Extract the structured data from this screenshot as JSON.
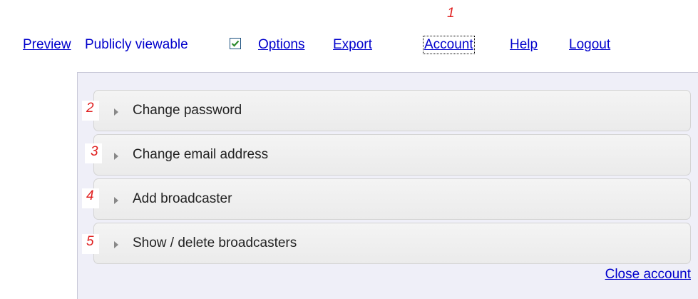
{
  "nav": {
    "preview": "Preview",
    "publicly_viewable": "Publicly viewable",
    "publicly_viewable_checked": true,
    "options": "Options",
    "export": "Export",
    "account": "Account",
    "help": "Help",
    "logout": "Logout"
  },
  "markers": [
    "1",
    "2",
    "3",
    "4",
    "5"
  ],
  "sections": [
    {
      "label": "Change password"
    },
    {
      "label": "Change email address"
    },
    {
      "label": "Add broadcaster"
    },
    {
      "label": "Show / delete broadcasters"
    }
  ],
  "close_account": "Close account",
  "colors": {
    "link": "#0000cc",
    "marker": "#e02020",
    "panel_bg": "#efeff8",
    "checkmark": "#2e8b2e"
  }
}
